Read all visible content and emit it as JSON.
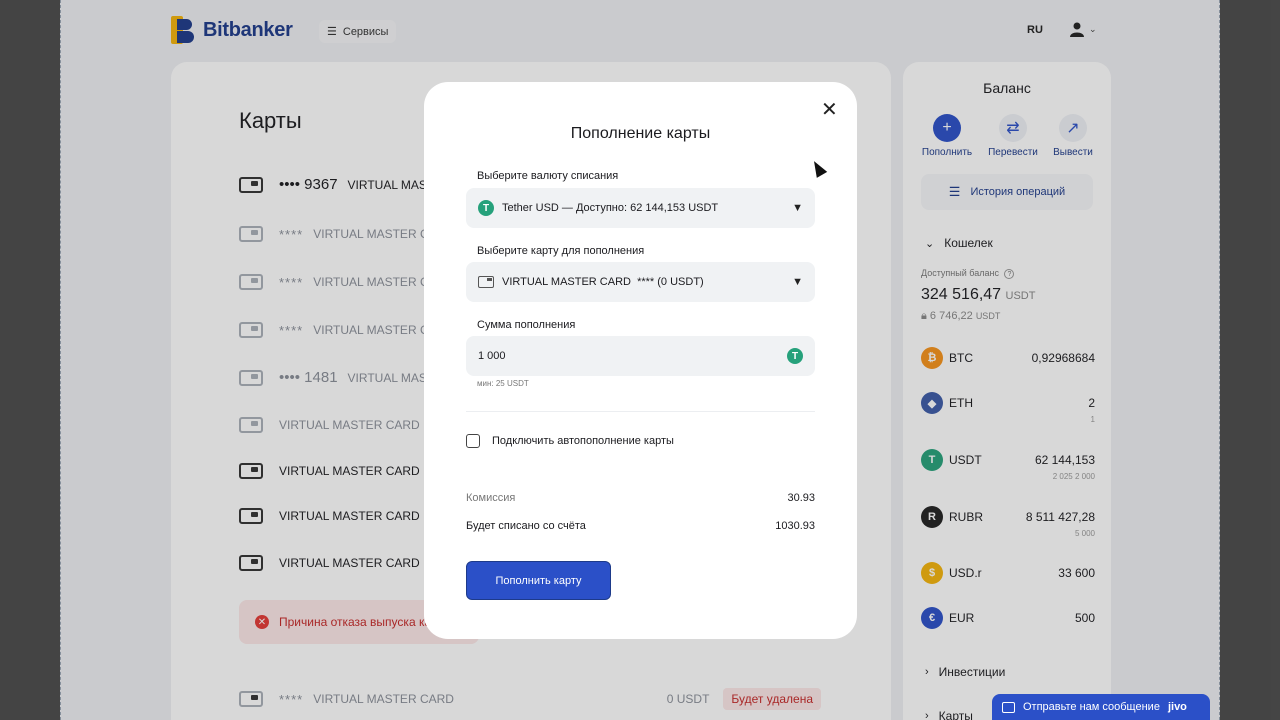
{
  "app": {
    "brand": "Bitbanker",
    "services_label": "Сервисы",
    "lang": "RU"
  },
  "cards_page": {
    "title": "Карты",
    "rows": [
      {
        "masked": "•••• 9367",
        "name": "VIRTUAL MASTE",
        "style": "num"
      },
      {
        "masked": "****",
        "name": "VIRTUAL MASTER CA",
        "style": "stars"
      },
      {
        "masked": "****",
        "name": "VIRTUAL MASTER CA",
        "style": "stars"
      },
      {
        "masked": "****",
        "name": "VIRTUAL MASTER CA",
        "style": "stars"
      },
      {
        "masked": "•••• 1481",
        "name": "VIRTUAL MAST",
        "style": "num"
      },
      {
        "masked": "",
        "name": "VIRTUAL MASTER CARD",
        "style": "plain"
      },
      {
        "masked": "",
        "name": "VIRTUAL MASTER CARD",
        "style": "plain"
      },
      {
        "masked": "",
        "name": "VIRTUAL MASTER CARD",
        "style": "plain"
      },
      {
        "masked": "",
        "name": "VIRTUAL MASTER CARD",
        "style": "plain"
      }
    ],
    "alert_text": "Причина отказа выпуска ка",
    "bottom_row": {
      "masked": "****",
      "name": "VIRTUAL MASTER CARD",
      "balance": "0 USDT",
      "badge": "Будет удалена"
    }
  },
  "sidebar": {
    "title": "Баланс",
    "actions": [
      {
        "label": "Пополнить",
        "icon": "plus-icon"
      },
      {
        "label": "Перевести",
        "icon": "transfer-icon"
      },
      {
        "label": "Вывести",
        "icon": "withdraw-icon"
      }
    ],
    "history_label": "История операций",
    "wallet_label": "Кошелек",
    "available_label": "Доступный баланс",
    "available_value": "324 516,47",
    "available_unit": "USDT",
    "locked_value": "6 746,22",
    "locked_unit": "USDT",
    "coins": [
      {
        "symbol": "BTC",
        "amount": "0,92968684",
        "sub": "",
        "color": "#f7931a",
        "glyph": "₿"
      },
      {
        "symbol": "ETH",
        "amount": "2",
        "sub": "1",
        "color": "#3c5ba8",
        "glyph": "◆"
      },
      {
        "symbol": "USDT",
        "amount": "62 144,153",
        "sub": "2 025   2 000",
        "color": "#26a17b",
        "glyph": "T"
      },
      {
        "symbol": "RUBR",
        "amount": "8 511 427,28",
        "sub": "5 000",
        "color": "#222222",
        "glyph": "R"
      },
      {
        "symbol": "USD.r",
        "amount": "33 600",
        "sub": "",
        "color": "#f5b40a",
        "glyph": "$"
      },
      {
        "symbol": "EUR",
        "amount": "500",
        "sub": "",
        "color": "#2b50c8",
        "glyph": "€"
      }
    ],
    "investments_label": "Инвестиции",
    "cards_label": "Карты"
  },
  "modal": {
    "title": "Пополнение карты",
    "currency_label": "Выберите валюту списания",
    "currency_value": "Tether USD — Доступно: 62 144,153 USDT",
    "card_label": "Выберите карту для пополнения",
    "card_value": "VIRTUAL MASTER CARD  **** (0 USDT)",
    "amount_label": "Сумма пополнения",
    "amount_value": "1 000",
    "min_hint": "мин: 25 USDT",
    "auto_topup_label": "Подключить автопополнение карты",
    "commission_label": "Комиссия",
    "commission_value": "30.93",
    "total_label": "Будет списано со счёта",
    "total_value": "1030.93",
    "submit_label": "Пополнить карту"
  },
  "chat_widget": {
    "label": "Отправьте нам сообщение",
    "brand": "jivo"
  }
}
